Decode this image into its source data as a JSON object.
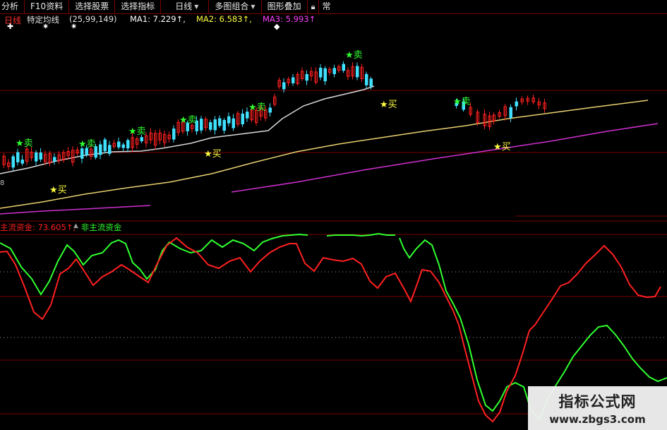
{
  "toolbar": {
    "buttons": [
      {
        "label": "分析"
      },
      {
        "label": "F10资料"
      },
      {
        "label": "选择股票"
      },
      {
        "label": "选择指标"
      },
      {
        "label": "日线"
      },
      {
        "label": "多图组合"
      },
      {
        "label": "图形叠加"
      }
    ],
    "cut_label": "常"
  },
  "main_panel": {
    "period": "日线",
    "indicator_name": "特定均线",
    "indicator_params": "(25,99,149)",
    "ma1": {
      "label": "MA1: 7.229↑,",
      "color": "#ffffff"
    },
    "ma2": {
      "label": "MA2: 6.583↑,",
      "color": "#ffff40"
    },
    "ma3": {
      "label": "MA3: 5.993↑",
      "color": "#ff40ff"
    },
    "axis_tick": "8",
    "signals": [
      {
        "label": "★卖",
        "type": "sell"
      },
      {
        "label": "★卖",
        "type": "sell"
      },
      {
        "label": "★卖",
        "type": "sell"
      },
      {
        "label": "★卖",
        "type": "sell"
      },
      {
        "label": "★卖",
        "type": "sell"
      },
      {
        "label": "★卖",
        "type": "sell"
      },
      {
        "label": "★卖",
        "type": "sell"
      },
      {
        "label": "★买",
        "type": "buy"
      },
      {
        "label": "★买",
        "type": "buy"
      },
      {
        "label": "★买",
        "type": "buy"
      },
      {
        "label": "★买",
        "type": "buy"
      }
    ]
  },
  "sub_panel": {
    "main_fund": {
      "label": "主流资金: 73.605↑,",
      "color": "#ff2020"
    },
    "non_main_fund": {
      "label": "非主流资金",
      "color": "#30ff30"
    }
  },
  "colors": {
    "up_candle": "#ff2020",
    "down_candle": "#40e0ff",
    "grid": "#7a0000",
    "dotted": "#aaaaaa"
  },
  "watermark": {
    "title": "指标公式网",
    "url": "www.zbgs3.com"
  }
}
